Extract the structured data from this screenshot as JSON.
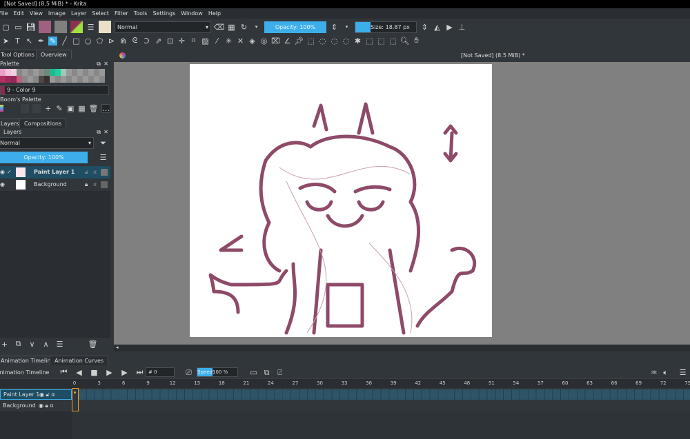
{
  "window": {
    "title": "[Not Saved]  (8.5 MiB) * - Krita"
  },
  "menu": [
    "File",
    "Edit",
    "View",
    "Image",
    "Layer",
    "Select",
    "Filter",
    "Tools",
    "Settings",
    "Window",
    "Help"
  ],
  "toolbar": {
    "blend_mode": "Normal",
    "opacity": "Opacity: 100%",
    "size": "Size: 18.87 px"
  },
  "docker_tabs": [
    "Tool Options",
    "Overview"
  ],
  "palette": {
    "title": "Palette",
    "selected_color": "9 - Color 9",
    "palette_name": "Boom's Palette",
    "colors_row1": [
      "#e8a0c8",
      "#f4c0dc",
      "#f0d0e0",
      "#888",
      "#999",
      "#888",
      "#999",
      "#888",
      "#6a8a7a",
      "#20b890",
      "#20d0a0",
      "#a0c8b8",
      "#999",
      "#888",
      "#999",
      "#888",
      "#999",
      "#888",
      "#999"
    ],
    "colors_row2": [
      "#b03060",
      "#a02860",
      "#902858",
      "#c06080",
      "#888",
      "#999",
      "#888",
      "#504848",
      "#383030",
      "#999",
      "#888",
      "#999",
      "#888",
      "#999",
      "#888",
      "#999",
      "#888",
      "#999",
      "#888"
    ],
    "swatch_color": "#8c2850"
  },
  "layers_tabs": [
    "Layers",
    "Compositions"
  ],
  "layers": {
    "title": "Layers",
    "blend_mode": "Normal",
    "opacity": "Opacity:  100%",
    "items": [
      {
        "name": "Paint Layer 1",
        "selected": true
      },
      {
        "name": "Background",
        "selected": false
      }
    ]
  },
  "canvas": {
    "doc_title": "[Not Saved]  (8.5 MiB) *",
    "sketch_color": "#8e4a68"
  },
  "timeline": {
    "tabs": [
      "Animation Timeline",
      "Animation Curves"
    ],
    "title": "Animation Timeline",
    "frame": "# 0",
    "speed_label": "Speed:",
    "speed_value": "100 %",
    "ticks": [
      "0",
      "3",
      "6",
      "9",
      "12",
      "15",
      "18",
      "21",
      "24",
      "27",
      "30",
      "33",
      "36",
      "39",
      "42",
      "45",
      "48",
      "51",
      "54",
      "57",
      "60",
      "63",
      "66",
      "69",
      "72",
      "75"
    ],
    "layers": [
      "Paint Layer 1",
      "Background"
    ]
  }
}
